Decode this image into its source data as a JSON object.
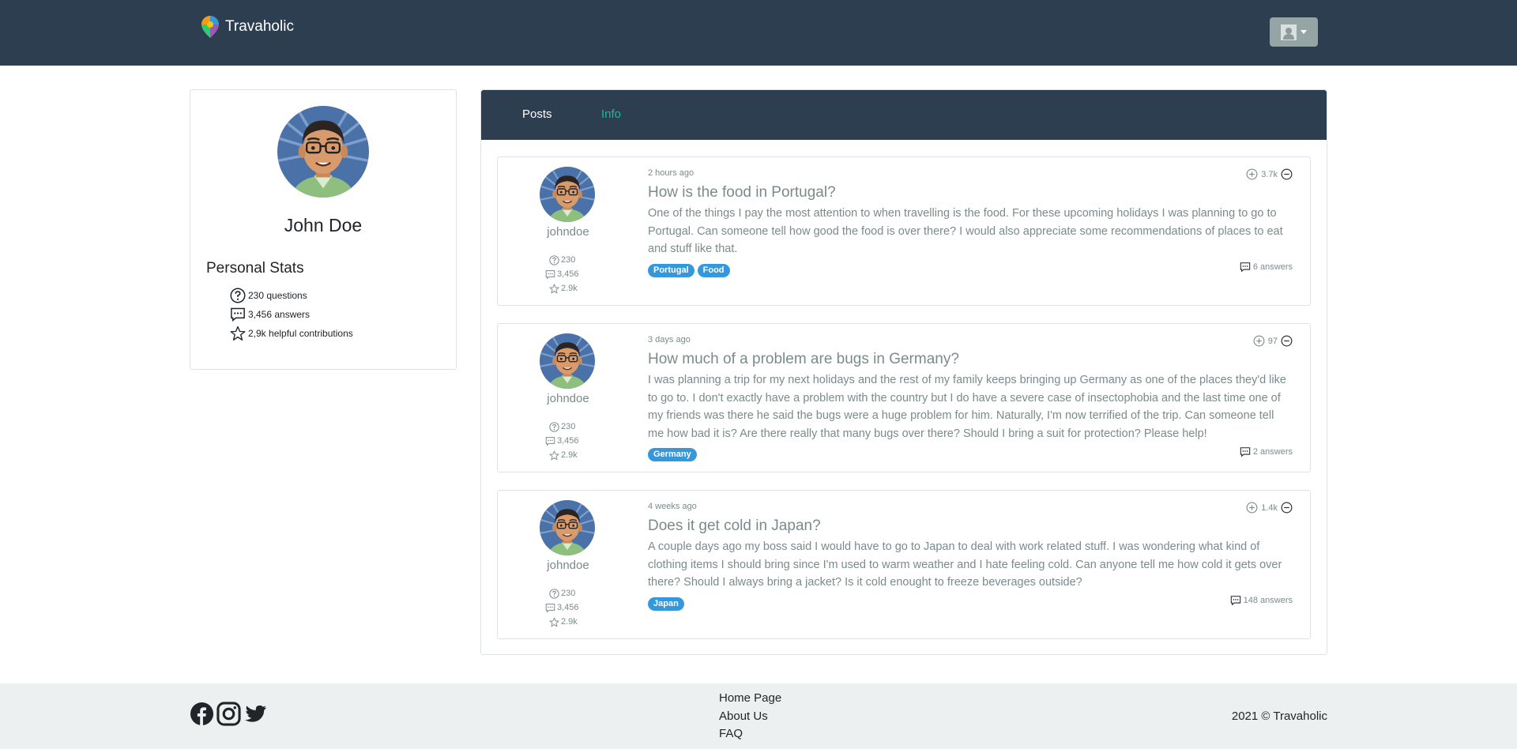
{
  "navbar": {
    "brand": "Travaholic",
    "colors": {
      "background": "#2c3e50",
      "user_button": "#95a5a6"
    },
    "user_menu_icon": "user-placeholder-icon"
  },
  "profile": {
    "name": "John Doe",
    "stats_title": "Personal Stats",
    "stats": [
      {
        "icon": "question-icon",
        "text": "230 questions"
      },
      {
        "icon": "comment-icon",
        "text": "3,456 answers"
      },
      {
        "icon": "star-icon",
        "text": "2,9k helpful contributions"
      }
    ]
  },
  "tabs": [
    {
      "label": "Posts",
      "active": false
    },
    {
      "label": "Info",
      "active": true
    }
  ],
  "posts": [
    {
      "username": "johndoe",
      "user_questions": "230",
      "user_answers": "3,456",
      "user_contributions": "2.9k",
      "time": "2 hours ago",
      "title": "How is the food in Portugal?",
      "body": "One of the things I pay the most attention to when travelling is the food. For these upcoming holidays I was planning to go to Portugal. Can someone tell how good the food is over there? I would also appreciate some recommendations of places to eat and stuff like that.",
      "tags": [
        "Portugal",
        "Food"
      ],
      "votes": "3.7k",
      "answers": "6 answers"
    },
    {
      "username": "johndoe",
      "user_questions": "230",
      "user_answers": "3,456",
      "user_contributions": "2.9k",
      "time": "3 days ago",
      "title": "How much of a problem are bugs in Germany?",
      "body": "I was planning a trip for my next holidays and the rest of my family keeps bringing up Germany as one of the places they'd like to go to. I don't exactly have a problem with the country but I do have a severe case of insectophobia and the last time one of my friends was there he said the bugs were a huge problem for him. Naturally, I'm now terrified of the trip. Can someone tell me how bad it is? Are there really that many bugs over there? Should I bring a suit for protection? Please help!",
      "tags": [
        "Germany"
      ],
      "votes": "97",
      "answers": "2 answers"
    },
    {
      "username": "johndoe",
      "user_questions": "230",
      "user_answers": "3,456",
      "user_contributions": "2.9k",
      "time": "4 weeks ago",
      "title": "Does it get cold in Japan?",
      "body": "A couple days ago my boss said I would have to go to Japan to deal with work related stuff. I was wondering what kind of clothing items I should bring since I'm used to warm weather and I hate feeling cold. Can anyone tell me how cold it gets over there? Should I always bring a jacket? Is it cold enought to freeze beverages outside?",
      "tags": [
        "Japan"
      ],
      "votes": "1.4k",
      "answers": "148 answers"
    }
  ],
  "footer": {
    "social_icons": [
      "facebook-icon",
      "instagram-icon",
      "twitter-icon"
    ],
    "links": [
      "Home Page",
      "About Us",
      "FAQ"
    ],
    "copyright": "2021 © Travaholic"
  }
}
